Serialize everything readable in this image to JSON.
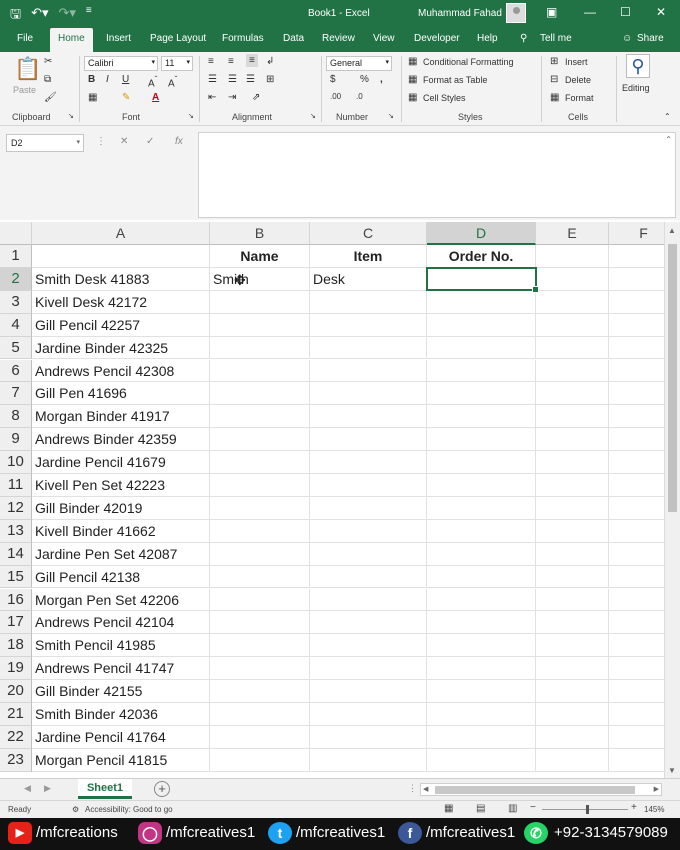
{
  "window": {
    "title": "Book1  -  Excel",
    "user": "Muhammad Fahad"
  },
  "ribbon_tabs": [
    "File",
    "Home",
    "Insert",
    "Page Layout",
    "Formulas",
    "Data",
    "Review",
    "View",
    "Developer",
    "Help"
  ],
  "tell_me": "Tell me",
  "share": "Share",
  "ribbon": {
    "clipboard_label": "Clipboard",
    "paste_label": "Paste",
    "font_label": "Font",
    "font_name": "Calibri",
    "font_size": "11",
    "alignment_label": "Alignment",
    "number_label": "Number",
    "number_format": "General",
    "styles_label": "Styles",
    "conditional_formatting": "Conditional Formatting",
    "format_as_table": "Format as Table",
    "cell_styles": "Cell Styles",
    "cells_label": "Cells",
    "insert": "Insert",
    "delete": "Delete",
    "format": "Format",
    "editing": "Editing"
  },
  "formula_bar": {
    "name_box": "D2",
    "formula": ""
  },
  "sheet": {
    "columns": [
      "A",
      "B",
      "C",
      "D",
      "E",
      "F"
    ],
    "selected_column": "D",
    "selected_row": 2,
    "rows": [
      {
        "n": "1",
        "a": "",
        "b": "Name",
        "c": "Item",
        "d": "Order No."
      },
      {
        "n": "2",
        "a": "Smith Desk 41883",
        "b": "Smith",
        "c": "Desk",
        "d": ""
      },
      {
        "n": "3",
        "a": "Kivell Desk 42172",
        "b": "",
        "c": "",
        "d": ""
      },
      {
        "n": "4",
        "a": "Gill Pencil 42257",
        "b": "",
        "c": "",
        "d": ""
      },
      {
        "n": "5",
        "a": "Jardine Binder 42325",
        "b": "",
        "c": "",
        "d": ""
      },
      {
        "n": "6",
        "a": "Andrews Pencil 42308",
        "b": "",
        "c": "",
        "d": ""
      },
      {
        "n": "7",
        "a": "Gill Pen 41696",
        "b": "",
        "c": "",
        "d": ""
      },
      {
        "n": "8",
        "a": "Morgan Binder 41917",
        "b": "",
        "c": "",
        "d": ""
      },
      {
        "n": "9",
        "a": "Andrews Binder 42359",
        "b": "",
        "c": "",
        "d": ""
      },
      {
        "n": "10",
        "a": "Jardine Pencil 41679",
        "b": "",
        "c": "",
        "d": ""
      },
      {
        "n": "11",
        "a": "Kivell Pen Set 42223",
        "b": "",
        "c": "",
        "d": ""
      },
      {
        "n": "12",
        "a": "Gill Binder 42019",
        "b": "",
        "c": "",
        "d": ""
      },
      {
        "n": "13",
        "a": "Kivell Binder 41662",
        "b": "",
        "c": "",
        "d": ""
      },
      {
        "n": "14",
        "a": "Jardine Pen Set 42087",
        "b": "",
        "c": "",
        "d": ""
      },
      {
        "n": "15",
        "a": "Gill Pencil 42138",
        "b": "",
        "c": "",
        "d": ""
      },
      {
        "n": "16",
        "a": "Morgan Pen Set 42206",
        "b": "",
        "c": "",
        "d": ""
      },
      {
        "n": "17",
        "a": "Andrews Pencil 42104",
        "b": "",
        "c": "",
        "d": ""
      },
      {
        "n": "18",
        "a": "Smith Pencil 41985",
        "b": "",
        "c": "",
        "d": ""
      },
      {
        "n": "19",
        "a": "Andrews Pencil 41747",
        "b": "",
        "c": "",
        "d": ""
      },
      {
        "n": "20",
        "a": "Gill Binder 42155",
        "b": "",
        "c": "",
        "d": ""
      },
      {
        "n": "21",
        "a": "Smith Binder 42036",
        "b": "",
        "c": "",
        "d": ""
      },
      {
        "n": "22",
        "a": "Jardine Pencil 41764",
        "b": "",
        "c": "",
        "d": ""
      },
      {
        "n": "23",
        "a": "Morgan Pencil 41815",
        "b": "",
        "c": "",
        "d": ""
      }
    ]
  },
  "sheet_tab": "Sheet1",
  "status": {
    "ready": "Ready",
    "accessibility": "Accessibility: Good to go",
    "zoom": "145%"
  },
  "social": {
    "youtube": "/mfcreations",
    "instagram": "/mfcreatives1",
    "twitter": "/mfcreatives1",
    "facebook": "/mfcreatives1",
    "whatsapp": "+92-3134579089"
  },
  "colors": {
    "excel_green": "#217346",
    "youtube_red": "#e62117",
    "twitter_blue": "#1da1f2",
    "facebook_blue": "#3b5998",
    "whatsapp_green": "#25d366"
  }
}
